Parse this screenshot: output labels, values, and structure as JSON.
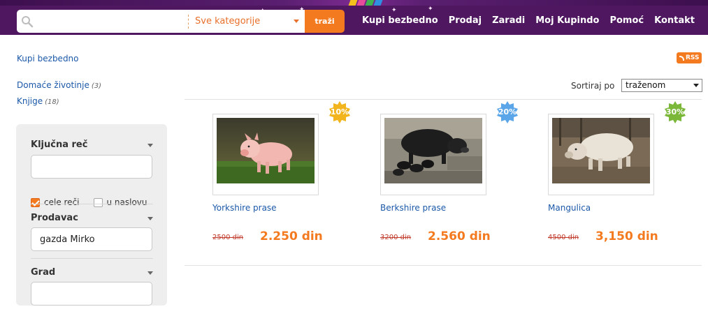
{
  "header": {
    "search": {
      "value": "",
      "placeholder": ""
    },
    "category": {
      "selected": "Sve kategorije"
    },
    "search_button": "traži",
    "nav": [
      "Kupi bezbedno",
      "Prodaj",
      "Zaradi",
      "Moj Kupindo",
      "Pomoć",
      "Kontakt"
    ]
  },
  "sidebar": {
    "top_link": "Kupi bezbedno",
    "categories": [
      {
        "label": "Domaće životinje",
        "count": "(3)"
      },
      {
        "label": "Knjige",
        "count": "(18)"
      }
    ],
    "filters": {
      "keyword": {
        "title": "Ključna reč",
        "value": "",
        "options": [
          {
            "label": "cele reči",
            "checked": true
          },
          {
            "label": "u naslovu",
            "checked": false
          }
        ]
      },
      "seller": {
        "title": "Prodavac",
        "value": "gazda Mirko"
      },
      "city": {
        "title": "Grad",
        "value": ""
      }
    }
  },
  "results": {
    "rss_label": "RSS",
    "sort": {
      "label": "Sortiraj po",
      "selected": "traženom"
    },
    "products": [
      {
        "title": "Yorkshire prase",
        "old_price": "2500 din",
        "price": "2.250 din",
        "discount": "10%",
        "badge_color": "#f2b51d",
        "image": "pink pig standing on grass"
      },
      {
        "title": "Berkshire prase",
        "old_price": "3200 din",
        "price": "2.560 din",
        "discount": "20%",
        "badge_color": "#5aa6e8",
        "image": "black sow with piglets"
      },
      {
        "title": "Mangulica",
        "old_price": "4500 din",
        "price": "3,150 din",
        "discount": "30%",
        "badge_color": "#7bb83a",
        "image": "woolly mangalica pig"
      }
    ]
  },
  "colors": {
    "header_bg": "#4e1760",
    "accent": "#f47a1f",
    "link": "#1b58a8",
    "old_price": "#c0392b"
  }
}
